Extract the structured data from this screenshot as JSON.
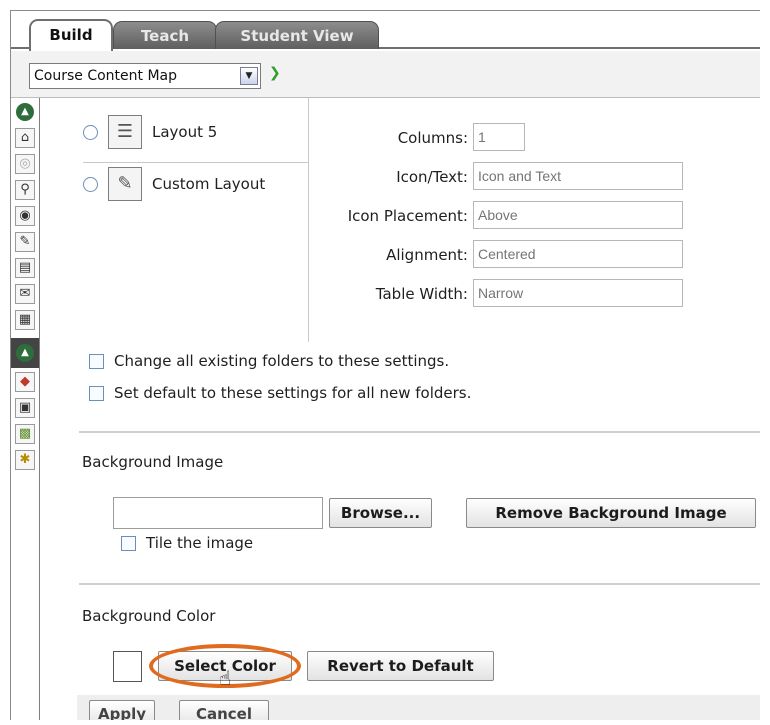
{
  "tabs": [
    {
      "label": "Build"
    },
    {
      "label": "Teach"
    },
    {
      "label": "Student View"
    }
  ],
  "toolbar": {
    "map_select_value": "Course Content Map",
    "go_glyph": "❯"
  },
  "layouts": [
    {
      "label": "Layout 5",
      "icon": "layout-5-icon"
    },
    {
      "label": "Custom Layout",
      "icon": "custom-layout-icon"
    }
  ],
  "fields": {
    "columns": {
      "label": "Columns:",
      "placeholder": "1"
    },
    "icon_text": {
      "label": "Icon/Text:",
      "placeholder": "Icon and Text"
    },
    "icon_placement": {
      "label": "Icon Placement:",
      "placeholder": "Above"
    },
    "alignment": {
      "label": "Alignment:",
      "placeholder": "Centered"
    },
    "table_width": {
      "label": "Table Width:",
      "placeholder": "Narrow"
    }
  },
  "checks": {
    "change_all": "Change all existing folders to these settings.",
    "set_default": "Set default to these settings for all new folders."
  },
  "background_image": {
    "section_label": "Background Image",
    "browse_label": "Browse...",
    "remove_label": "Remove Background Image",
    "tile_label": "Tile the image"
  },
  "background_color": {
    "section_label": "Background Color",
    "select_label": "Select Color",
    "revert_label": "Revert to Default"
  },
  "footer": {
    "apply_label": "Apply",
    "cancel_label": "Cancel"
  },
  "colors": {
    "highlight_ring": "#e06a1e",
    "go_arrow": "#2f9e2f"
  }
}
